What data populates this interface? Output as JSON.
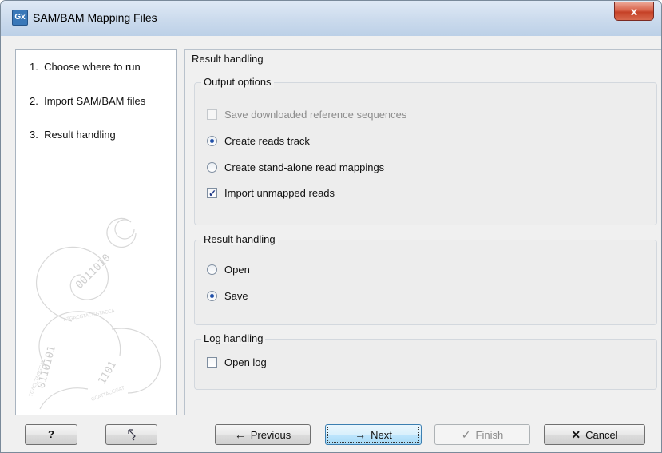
{
  "window": {
    "title": "SAM/BAM Mapping Files",
    "app_icon": "Gx",
    "close_label": "x"
  },
  "steps": [
    {
      "number": "1.",
      "label": "Choose where to run"
    },
    {
      "number": "2.",
      "label": "Import SAM/BAM files"
    },
    {
      "number": "3.",
      "label": "Result handling"
    }
  ],
  "panel": {
    "title": "Result handling"
  },
  "output_options": {
    "title": "Output options",
    "save_downloaded": {
      "label": "Save downloaded reference sequences",
      "checked": false,
      "enabled": false
    },
    "create_reads_track": {
      "label": "Create reads track",
      "selected": true
    },
    "create_standalone": {
      "label": "Create stand-alone read mappings",
      "selected": false
    },
    "import_unmapped": {
      "label": "Import unmapped reads",
      "checked": true
    }
  },
  "result_handling": {
    "title": "Result handling",
    "open": {
      "label": "Open",
      "selected": false
    },
    "save": {
      "label": "Save",
      "selected": true
    }
  },
  "log_handling": {
    "title": "Log handling",
    "open_log": {
      "label": "Open log",
      "checked": false
    }
  },
  "buttons": {
    "help": "?",
    "previous": "Previous",
    "next": "Next",
    "finish": "Finish",
    "cancel": "Cancel"
  },
  "icons": {
    "help": "question-icon",
    "reset": "reset-arrow-icon",
    "previous": "arrow-left-icon",
    "next": "arrow-right-icon",
    "finish": "checkmark-icon",
    "cancel": "x-icon"
  },
  "colors": {
    "accent": "#1f4fa8",
    "close_button": "#c54127"
  }
}
